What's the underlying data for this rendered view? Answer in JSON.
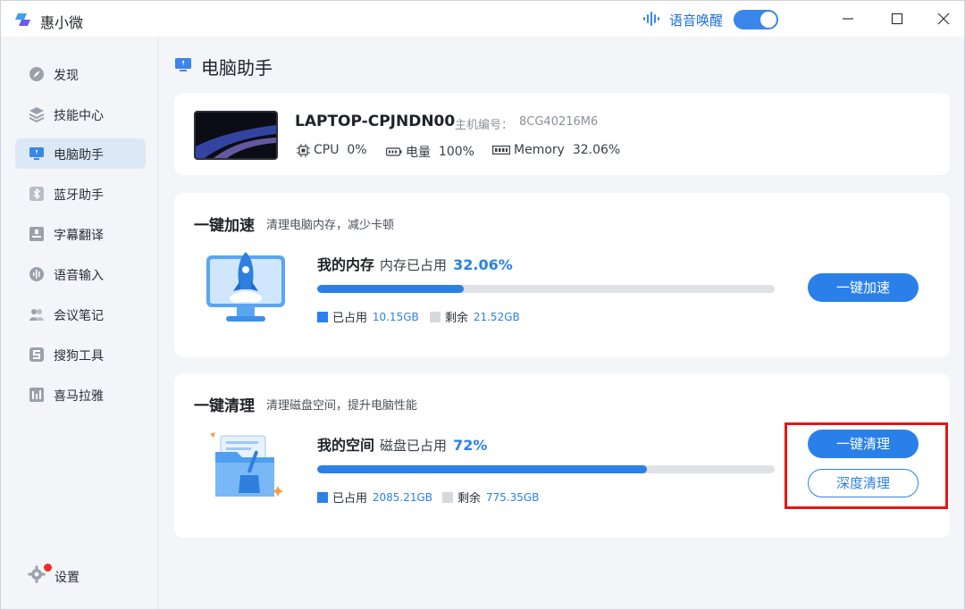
{
  "app": {
    "title": "惠小微"
  },
  "titlebar": {
    "voice_wake_label": "语音唤醒",
    "voice_wake_on": true
  },
  "sidebar": {
    "items": [
      {
        "label": "发现",
        "icon": "discover-icon"
      },
      {
        "label": "技能中心",
        "icon": "layers-icon"
      },
      {
        "label": "电脑助手",
        "icon": "monitor-icon",
        "active": true
      },
      {
        "label": "蓝牙助手",
        "icon": "bluetooth-icon"
      },
      {
        "label": "字幕翻译",
        "icon": "subtitle-icon"
      },
      {
        "label": "语音输入",
        "icon": "voice-wave-icon"
      },
      {
        "label": "会议笔记",
        "icon": "meeting-icon"
      },
      {
        "label": "搜狗工具",
        "icon": "sogou-icon"
      },
      {
        "label": "喜马拉雅",
        "icon": "ximalaya-icon"
      }
    ],
    "settings_label": "设置"
  },
  "page": {
    "title": "电脑助手"
  },
  "device": {
    "name": "LAPTOP-CPJNDN00",
    "serial_label": "主机编号：",
    "serial_value": "8CG40216M6",
    "cpu_label": "CPU",
    "cpu_value": "0%",
    "battery_label": "电量",
    "battery_value": "100%",
    "memory_label": "Memory",
    "memory_value": "32.06%"
  },
  "speedup": {
    "title": "一键加速",
    "subtitle": "清理电脑内存，减少卡顿",
    "metric_name": "我的内存",
    "metric_desc": "内存已占用",
    "metric_pct": "32.06%",
    "used_fraction": 0.3206,
    "used_label": "已占用",
    "used_value": "10.15GB",
    "free_label": "剩余",
    "free_value": "21.52GB",
    "button": "一键加速"
  },
  "cleanup": {
    "title": "一键清理",
    "subtitle": "清理磁盘空间，提升电脑性能",
    "metric_name": "我的空间",
    "metric_desc": "磁盘已占用",
    "metric_pct": "72%",
    "used_fraction": 0.72,
    "used_label": "已占用",
    "used_value": "2085.21GB",
    "free_label": "剩余",
    "free_value": "775.35GB",
    "button_primary": "一键清理",
    "button_secondary": "深度清理"
  },
  "colors": {
    "accent": "#2a80e8",
    "highlight": "#e81515",
    "used": "#2a80e8",
    "free": "#d6d8dc"
  }
}
